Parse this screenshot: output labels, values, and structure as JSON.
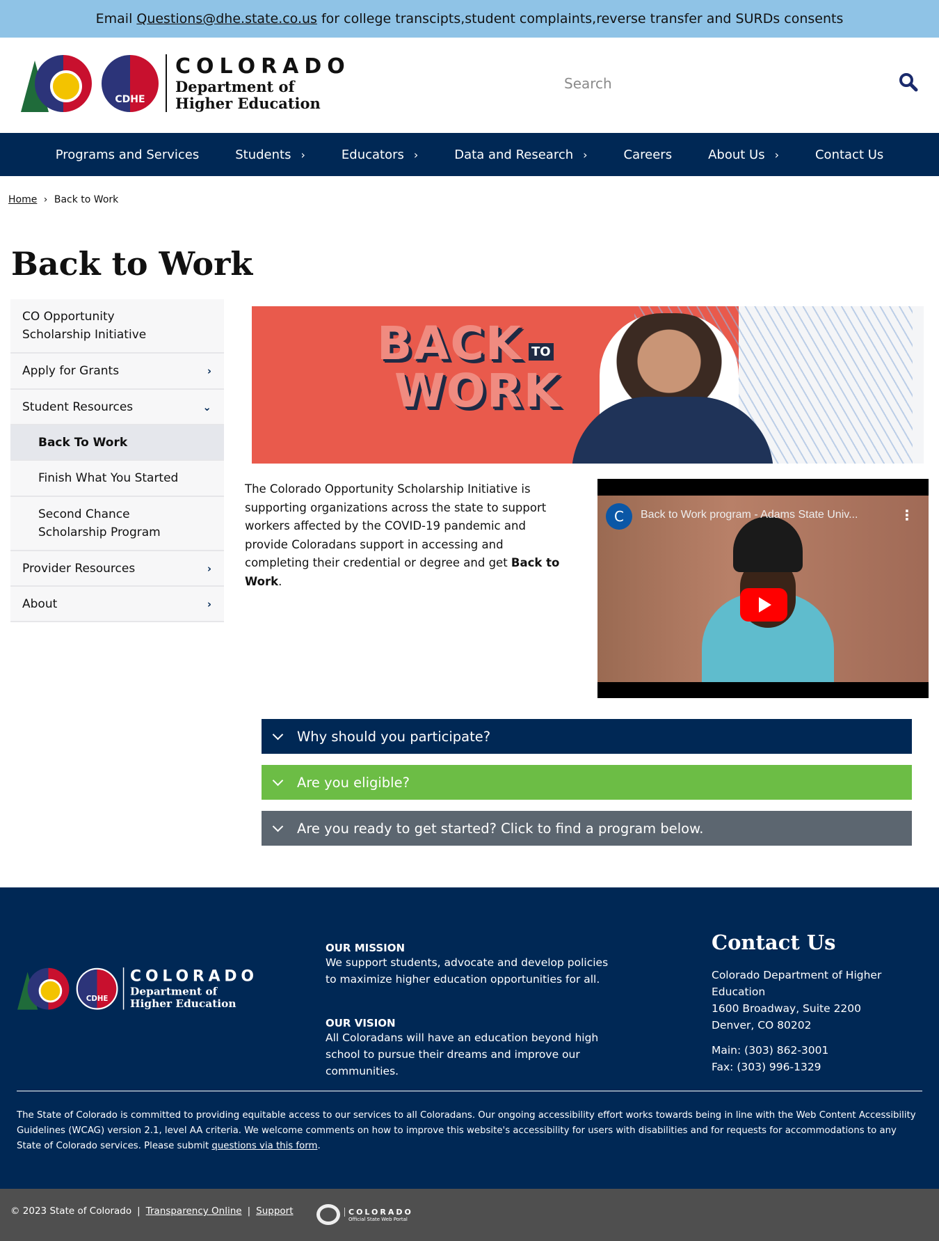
{
  "announcement": {
    "prefix": "Email",
    "email": "Questions@dhe.state.co.us",
    "suffix": "for college transcipts,student complaints,reverse transfer and SURDs consents"
  },
  "header": {
    "logo_state": "COLORADO",
    "logo_dept_line1": "Department of",
    "logo_dept_line2": "Higher Education",
    "logo_seal": "CDHE",
    "search_placeholder": "Search"
  },
  "nav": [
    {
      "label": "Programs and Services",
      "chev": ""
    },
    {
      "label": "Students",
      "chev": "›"
    },
    {
      "label": "Educators",
      "chev": "›"
    },
    {
      "label": "Data and Research",
      "chev": "›"
    },
    {
      "label": "Careers",
      "chev": ""
    },
    {
      "label": "About Us",
      "chev": "›"
    },
    {
      "label": "Contact Us",
      "chev": ""
    }
  ],
  "breadcrumb": {
    "home": "Home",
    "sep": "›",
    "current": "Back to Work"
  },
  "page_title": "Back to Work",
  "sidebar": [
    {
      "label": "CO Opportunity Scholarship Initiative",
      "chev": ""
    },
    {
      "label": "Apply for Grants",
      "chev": "›"
    },
    {
      "label": "Student Resources",
      "chev": "⌄"
    },
    {
      "label": "Back To Work",
      "chev": ""
    },
    {
      "label": "Finish What You Started",
      "chev": ""
    },
    {
      "label": "Second Chance Scholarship Program",
      "chev": ""
    },
    {
      "label": "Provider Resources",
      "chev": "›"
    },
    {
      "label": "About",
      "chev": "›"
    }
  ],
  "hero": {
    "line1": "BACK",
    "to": "TO",
    "line2": "WORK"
  },
  "intro": {
    "text": "The Colorado Opportunity Scholarship Initiative is supporting organizations across the state to support workers affected by the COVID-19 pandemic and provide Coloradans support in accessing and completing their credential or degree and get ",
    "bold": "Back to Work",
    "end": "."
  },
  "video": {
    "channel_initial": "C",
    "title": "Back to Work program - Adams State Univ..."
  },
  "accordions": [
    {
      "label": "Why should you participate?",
      "color": "#002855"
    },
    {
      "label": "Are you eligible?",
      "color": "#6cbd45"
    },
    {
      "label": "Are you ready to get started? Click to find a program below.",
      "color": "#5c6670"
    }
  ],
  "footer": {
    "mission_title": "OUR MISSION",
    "mission_text": "We support students, advocate and develop policies to maximize higher education opportunities for all.",
    "vision_title": "OUR VISION",
    "vision_text": "All Coloradans will have an education beyond high school to pursue their dreams and improve our communities.",
    "contact_title": "Contact Us",
    "org": "Colorado Department of Higher Education",
    "addr1": "1600 Broadway, Suite 2200",
    "addr2": "Denver, CO 80202",
    "main": "Main: (303) 862-3001",
    "fax": "Fax: (303) 996-1329",
    "accessibility": "The State of Colorado is committed to providing equitable access to our services to all Coloradans. Our ongoing accessibility effort works towards being in line with the Web Content Accessibility Guidelines (WCAG) version 2.1, level AA criteria. We welcome comments on how to improve this website's accessibility for users with disabilities and for requests for accommodations to any State of Colorado services. Please submit ",
    "accessibility_link": "questions via this form",
    "accessibility_end": "."
  },
  "bottom": {
    "copyright": "© 2023 State of Colorado",
    "sep": "|",
    "transparency": "Transparency Online",
    "support": "Support",
    "portal_title": "COLORADO",
    "portal_sub": "Official State Web Portal"
  }
}
